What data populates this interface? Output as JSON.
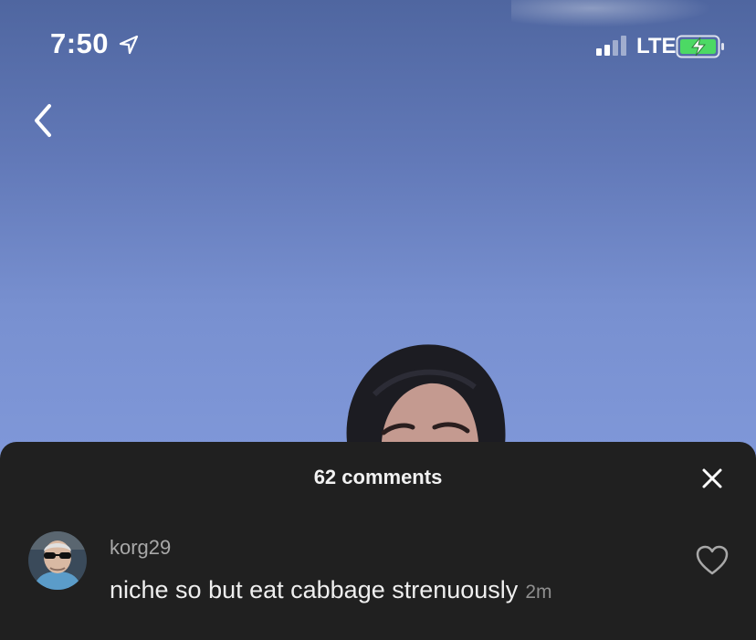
{
  "status_bar": {
    "time": "7:50",
    "network": "LTE",
    "icons": [
      "location-arrow-icon",
      "signal-icon",
      "battery-charging-icon"
    ]
  },
  "nav": {
    "back_icon": "chevron-left-icon"
  },
  "comments_panel": {
    "count_label": "62 comments",
    "close_icon": "close-icon",
    "comments": [
      {
        "username": "korg29",
        "text": "niche so but eat cabbage strenuously",
        "time": "2m",
        "like_icon": "heart-outline-icon"
      }
    ]
  },
  "colors": {
    "sky_top": "#4f66a0",
    "sky_bottom": "#8aa0dc",
    "sheet": "#202020",
    "battery_green": "#4cd964"
  }
}
